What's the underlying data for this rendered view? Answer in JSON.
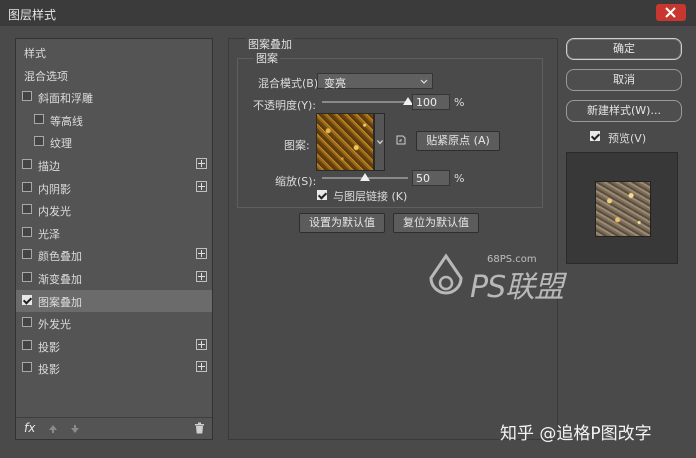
{
  "window": {
    "title": "图层样式"
  },
  "sidebar": {
    "items": [
      {
        "label": "样式",
        "checkbox": false,
        "plus": false,
        "checked": false,
        "indent": false,
        "active": false
      },
      {
        "label": "混合选项",
        "checkbox": false,
        "plus": false,
        "checked": false,
        "indent": false,
        "active": false
      },
      {
        "label": "斜面和浮雕",
        "checkbox": true,
        "plus": false,
        "checked": false,
        "indent": false,
        "active": false
      },
      {
        "label": "等高线",
        "checkbox": true,
        "plus": false,
        "checked": false,
        "indent": true,
        "active": false
      },
      {
        "label": "纹理",
        "checkbox": true,
        "plus": false,
        "checked": false,
        "indent": true,
        "active": false
      },
      {
        "label": "描边",
        "checkbox": true,
        "plus": true,
        "checked": false,
        "indent": false,
        "active": false
      },
      {
        "label": "内阴影",
        "checkbox": true,
        "plus": true,
        "checked": false,
        "indent": false,
        "active": false
      },
      {
        "label": "内发光",
        "checkbox": true,
        "plus": false,
        "checked": false,
        "indent": false,
        "active": false
      },
      {
        "label": "光泽",
        "checkbox": true,
        "plus": false,
        "checked": false,
        "indent": false,
        "active": false
      },
      {
        "label": "颜色叠加",
        "checkbox": true,
        "plus": true,
        "checked": false,
        "indent": false,
        "active": false
      },
      {
        "label": "渐变叠加",
        "checkbox": true,
        "plus": true,
        "checked": false,
        "indent": false,
        "active": false
      },
      {
        "label": "图案叠加",
        "checkbox": true,
        "plus": false,
        "checked": true,
        "indent": false,
        "active": true
      },
      {
        "label": "外发光",
        "checkbox": true,
        "plus": false,
        "checked": false,
        "indent": false,
        "active": false
      },
      {
        "label": "投影",
        "checkbox": true,
        "plus": true,
        "checked": false,
        "indent": false,
        "active": false
      },
      {
        "label": "投影",
        "checkbox": true,
        "plus": true,
        "checked": false,
        "indent": false,
        "active": false
      }
    ],
    "footer": {
      "fx_label": "fx"
    }
  },
  "panel": {
    "group_title": "图案叠加",
    "sub_title": "图案",
    "blend_mode_label": "混合模式(B):",
    "blend_mode_value": "变亮",
    "opacity_label": "不透明度(Y):",
    "opacity_value": "100",
    "opacity_percent": 100,
    "opacity_unit": "%",
    "pattern_label": "图案:",
    "snap_button": "贴紧原点 (A)",
    "scale_label": "缩放(S):",
    "scale_value": "50",
    "scale_percent": 50,
    "scale_unit": "%",
    "link_label": "与图层链接 (K)",
    "link_checked": true,
    "set_default_button": "设置为默认值",
    "reset_default_button": "复位为默认值"
  },
  "actions": {
    "ok": "确定",
    "cancel": "取消",
    "new_style": "新建样式(W)...",
    "preview_label": "预览(V)",
    "preview_checked": true
  },
  "watermark": {
    "site": "68PS.com",
    "brand": "PS联盟"
  },
  "credit": "知乎 @追格P图改字",
  "colors": {
    "close_button": "#c7372f",
    "pattern": "#b07a20"
  }
}
